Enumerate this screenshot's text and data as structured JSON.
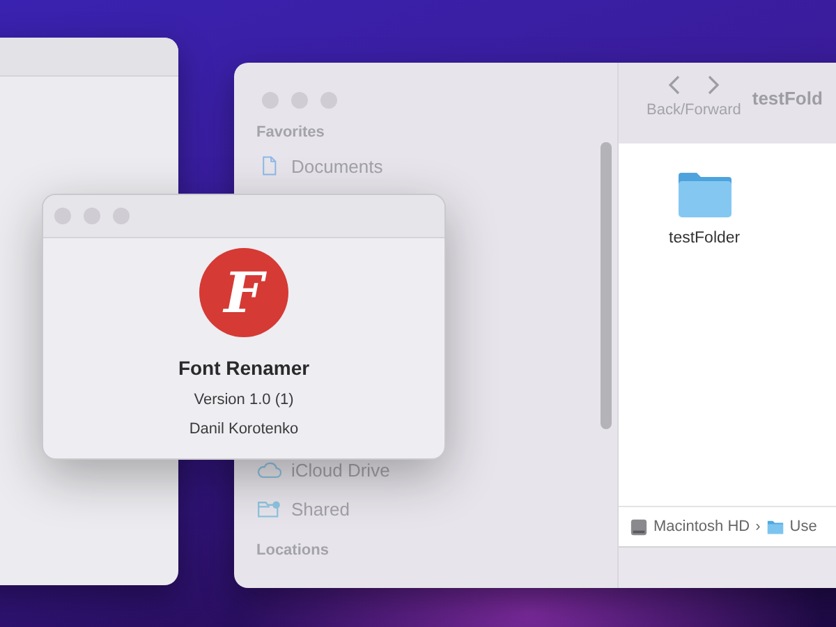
{
  "finder": {
    "title": "testFold",
    "nav_label": "Back/Forward",
    "sidebar": [
      {
        "kind": "heading",
        "label": "Favorites"
      },
      {
        "kind": "document",
        "label": "Documents"
      },
      {
        "kind": "cloud",
        "label": "iCloud Drive"
      },
      {
        "kind": "shared",
        "label": "Shared"
      },
      {
        "kind": "heading",
        "label": "Locations"
      }
    ],
    "files": [
      {
        "name": "testFolder"
      }
    ],
    "path": [
      {
        "kind": "disk",
        "label": "Macintosh HD"
      },
      {
        "kind": "folder",
        "label": "Use"
      }
    ],
    "path_separator": "›"
  },
  "about": {
    "logo_letter": "F",
    "app_name": "Font Renamer",
    "version": "Version 1.0 (1)",
    "author": "Danil Korotenko"
  }
}
